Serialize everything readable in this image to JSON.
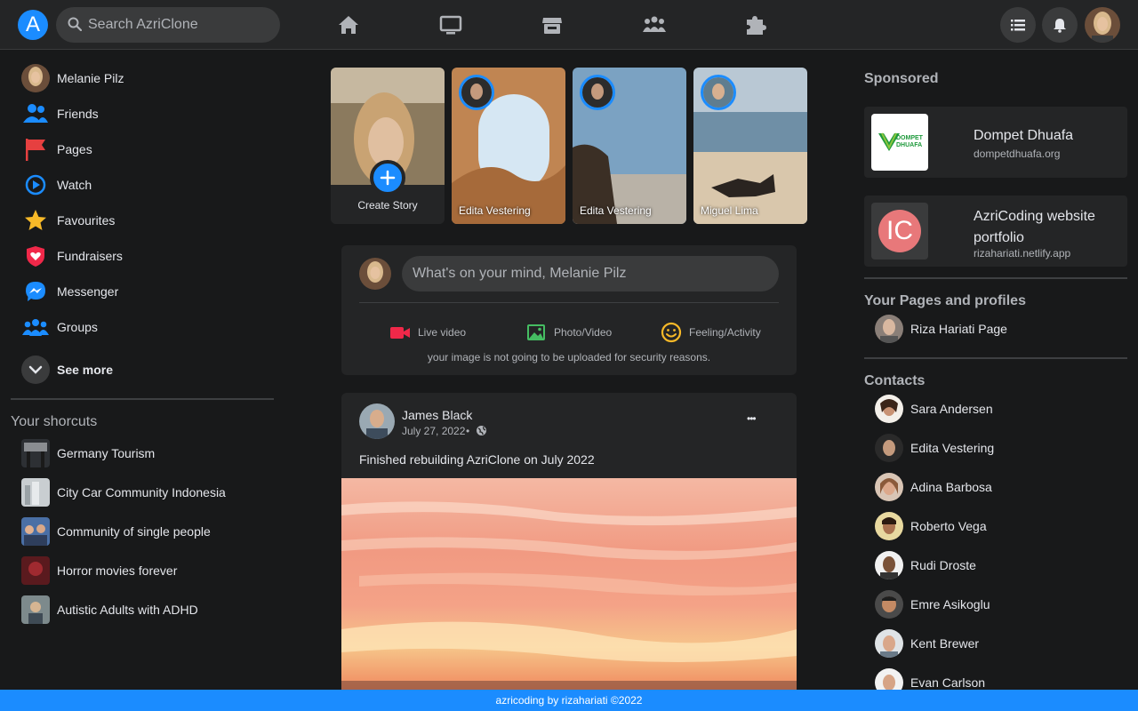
{
  "header": {
    "logo_letter": "A",
    "search_placeholder": "Search AzriClone",
    "nav_icons": [
      "home-icon",
      "watch-icon",
      "marketplace-icon",
      "groups-icon",
      "gaming-icon"
    ],
    "accent": "#1b8cff"
  },
  "sidebar": {
    "user_name": "Melanie Pilz",
    "items": [
      {
        "label": "Friends",
        "icon": "friends-icon"
      },
      {
        "label": "Pages",
        "icon": "pages-flag-icon"
      },
      {
        "label": "Watch",
        "icon": "watch-play-icon"
      },
      {
        "label": "Favourites",
        "icon": "star-icon"
      },
      {
        "label": "Fundraisers",
        "icon": "fundraiser-heart-icon"
      },
      {
        "label": "Messenger",
        "icon": "messenger-icon"
      },
      {
        "label": "Groups",
        "icon": "groups-icon"
      }
    ],
    "see_more": "See more",
    "shortcuts_title": "Your shorcuts",
    "shortcuts": [
      {
        "label": "Germany Tourism"
      },
      {
        "label": "City Car Community Indonesia"
      },
      {
        "label": "Community of single people"
      },
      {
        "label": "Horror movies forever"
      },
      {
        "label": "Autistic Adults with ADHD"
      }
    ]
  },
  "stories": {
    "create_label": "Create Story",
    "items": [
      {
        "name": "Edita Vestering"
      },
      {
        "name": "Edita Vestering"
      },
      {
        "name": "Miguel Lima"
      }
    ]
  },
  "composer": {
    "placeholder": "What's on your mind, Melanie Pilz",
    "actions": [
      {
        "label": "Live video",
        "icon": "live-video-icon"
      },
      {
        "label": "Photo/Video",
        "icon": "photo-icon"
      },
      {
        "label": "Feeling/Activity",
        "icon": "smiley-icon"
      }
    ],
    "note": "your image is not going to be uploaded for security reasons."
  },
  "post": {
    "author": "James Black",
    "date": "July 27, 2022",
    "separator": "•",
    "text": "Finished rebuilding AzriClone on July 2022",
    "more": "•••"
  },
  "right": {
    "sponsored_title": "Sponsored",
    "ads": [
      {
        "title": "Dompet Dhuafa",
        "url": "dompetdhuafa.org",
        "logo_text": "DOMPET DHUAFA"
      },
      {
        "title": "AzriCoding website portfolio",
        "url": "rizahariati.netlify.app",
        "logo_text": "IC"
      }
    ],
    "pages_title": "Your Pages and profiles",
    "page_name": "Riza Hariati Page",
    "contacts_title": "Contacts",
    "contacts": [
      {
        "name": "Sara Andersen"
      },
      {
        "name": "Edita Vestering"
      },
      {
        "name": "Adina Barbosa"
      },
      {
        "name": "Roberto Vega"
      },
      {
        "name": "Rudi Droste"
      },
      {
        "name": "Emre Asikoglu"
      },
      {
        "name": "Kent Brewer"
      },
      {
        "name": "Evan Carlson"
      }
    ]
  },
  "footer": {
    "text": "azricoding by rizahariati ©2022"
  }
}
